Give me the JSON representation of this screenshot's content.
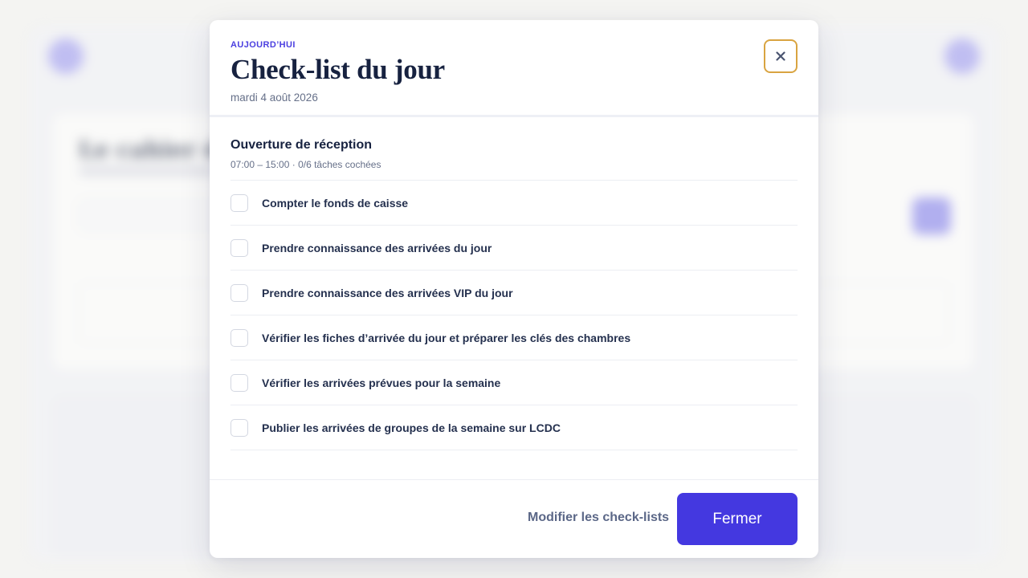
{
  "background": {
    "page_title": "Le cahier de..."
  },
  "modal": {
    "eyebrow": "AUJOURD’HUI",
    "title": "Check-list du jour",
    "date": "mardi 4 août 2026",
    "close_icon": "close-icon",
    "section": {
      "title": "Ouverture de réception",
      "meta": "07:00 – 15:00 · 0/6 tâches cochées",
      "tasks": [
        {
          "label": "Compter le fonds de caisse",
          "checked": false
        },
        {
          "label": "Prendre connaissance des arrivées du jour",
          "checked": false
        },
        {
          "label": "Prendre connaissance des arrivées VIP du jour",
          "checked": false
        },
        {
          "label": "Vérifier les fiches d’arrivée du jour et préparer les clés des chambres",
          "checked": false
        },
        {
          "label": "Vérifier les arrivées prévues pour la semaine",
          "checked": false
        },
        {
          "label": "Publier les arrivées de groupes de la semaine sur LCDC",
          "checked": false
        }
      ]
    },
    "footer": {
      "edit_label": "Modifier les check-lists",
      "close_label": "Fermer"
    }
  },
  "colors": {
    "accent": "#4438e0",
    "eyebrow": "#4b3fe0",
    "title": "#172240",
    "close_border": "#d9a441",
    "muted": "#667089"
  }
}
